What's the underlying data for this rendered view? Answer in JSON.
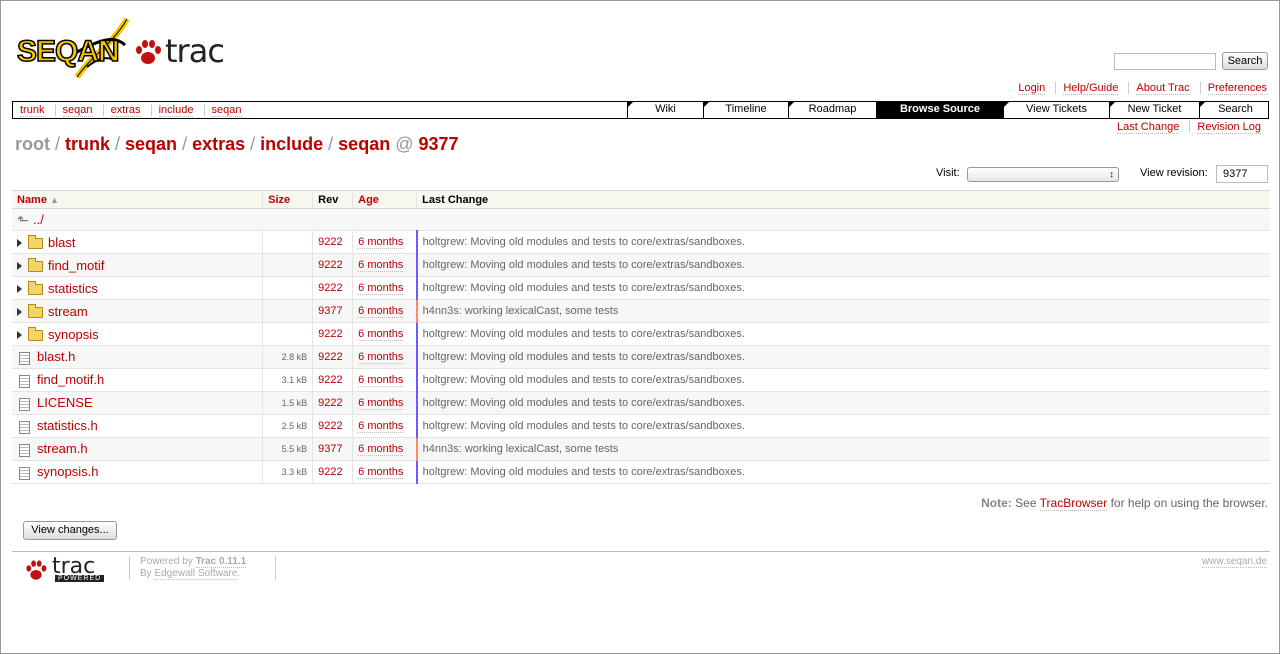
{
  "brand": {
    "project_logo_text": "SEQAN",
    "trac_logo_text": "trac"
  },
  "search": {
    "placeholder": "",
    "button_label": "Search"
  },
  "metanav": [
    "Login",
    "Help/Guide",
    "About Trac",
    "Preferences"
  ],
  "crumbs": [
    "trunk",
    "seqan",
    "extras",
    "include",
    "seqan"
  ],
  "mainnav": [
    {
      "label": "Wiki",
      "active": false
    },
    {
      "label": "Timeline",
      "active": false
    },
    {
      "label": "Roadmap",
      "active": false
    },
    {
      "label": "Browse Source",
      "active": true
    },
    {
      "label": "View Tickets",
      "active": false
    },
    {
      "label": "New Ticket",
      "active": false
    },
    {
      "label": "Search",
      "active": false
    }
  ],
  "ctxtnav": [
    "Last Change",
    "Revision Log"
  ],
  "path": {
    "root": "root",
    "parts": [
      "trunk",
      "seqan",
      "extras",
      "include",
      "seqan"
    ],
    "at": "@",
    "rev": "9377"
  },
  "jump": {
    "visit_label": "Visit:",
    "visit_value": "",
    "rev_label": "View revision:",
    "rev_value": "9377"
  },
  "table": {
    "headers": {
      "name": "Name",
      "size": "Size",
      "rev": "Rev",
      "age": "Age",
      "change": "Last Change"
    },
    "up": "../",
    "rows": [
      {
        "type": "dir",
        "name": "blast",
        "size": "",
        "rev": "9222",
        "age": "6 months",
        "change": "holtgrew: Moving old modules and tests to core/extras/sandboxes.",
        "color": "blue"
      },
      {
        "type": "dir",
        "name": "find_motif",
        "size": "",
        "rev": "9222",
        "age": "6 months",
        "change": "holtgrew: Moving old modules and tests to core/extras/sandboxes.",
        "color": "blue"
      },
      {
        "type": "dir",
        "name": "statistics",
        "size": "",
        "rev": "9222",
        "age": "6 months",
        "change": "holtgrew: Moving old modules and tests to core/extras/sandboxes.",
        "color": "blue"
      },
      {
        "type": "dir",
        "name": "stream",
        "size": "",
        "rev": "9377",
        "age": "6 months",
        "change": "h4nn3s: working lexicalCast, some tests",
        "color": "red"
      },
      {
        "type": "dir",
        "name": "synopsis",
        "size": "",
        "rev": "9222",
        "age": "6 months",
        "change": "holtgrew: Moving old modules and tests to core/extras/sandboxes.",
        "color": "blue"
      },
      {
        "type": "file",
        "name": "blast.h",
        "size": "2.8 kB",
        "rev": "9222",
        "age": "6 months",
        "change": "holtgrew: Moving old modules and tests to core/extras/sandboxes.",
        "color": "blue"
      },
      {
        "type": "file",
        "name": "find_motif.h",
        "size": "3.1 kB",
        "rev": "9222",
        "age": "6 months",
        "change": "holtgrew: Moving old modules and tests to core/extras/sandboxes.",
        "color": "blue"
      },
      {
        "type": "file",
        "name": "LICENSE",
        "size": "1.5 kB",
        "rev": "9222",
        "age": "6 months",
        "change": "holtgrew: Moving old modules and tests to core/extras/sandboxes.",
        "color": "blue"
      },
      {
        "type": "file",
        "name": "statistics.h",
        "size": "2.5 kB",
        "rev": "9222",
        "age": "6 months",
        "change": "holtgrew: Moving old modules and tests to core/extras/sandboxes.",
        "color": "blue"
      },
      {
        "type": "file",
        "name": "stream.h",
        "size": "5.5 kB",
        "rev": "9377",
        "age": "6 months",
        "change": "h4nn3s: working lexicalCast, some tests",
        "color": "red"
      },
      {
        "type": "file",
        "name": "synopsis.h",
        "size": "3.3 kB",
        "rev": "9222",
        "age": "6 months",
        "change": "holtgrew: Moving old modules and tests to core/extras/sandboxes.",
        "color": "blue"
      }
    ]
  },
  "note": {
    "label": "Note:",
    "before": "See",
    "link": "TracBrowser",
    "after": "for help on using the browser."
  },
  "view_changes_label": "View changes...",
  "footer": {
    "logo_text": "trac",
    "logo_sub": "POWERED",
    "powered_prefix": "Powered by",
    "trac_version": "Trac 0.11.1",
    "by_prefix": "By",
    "edgewall": "Edgewall Software",
    "right_link": "www.seqan.de"
  },
  "colors": {
    "link": "#bb0000",
    "blue_bar": "#6a5cff",
    "red_bar": "#ff8a6a"
  }
}
